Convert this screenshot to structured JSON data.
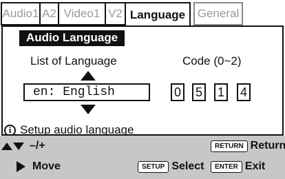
{
  "tabs": [
    {
      "label": "Audio1",
      "state": "inactive"
    },
    {
      "label": "A2",
      "state": "inactive"
    },
    {
      "label": "Video1",
      "state": "inactive"
    },
    {
      "label": "V2",
      "state": "inactive"
    },
    {
      "label": "Language",
      "state": "active"
    },
    {
      "label": "General",
      "state": "inactive"
    }
  ],
  "panel": {
    "section_title": "Audio Language",
    "list_label": "List of Language",
    "code_label": "Code (0~2)",
    "language_value": "en: English",
    "code_digits": [
      "0",
      "5",
      "1",
      "4"
    ]
  },
  "info": {
    "icon": "info-icon",
    "text": "Setup audio language"
  },
  "footer": {
    "updown_action": "–/+",
    "right_action": "Move",
    "setup_key": "SETUP",
    "setup_action": "Select",
    "return_key": "RETURN",
    "return_action": "Return",
    "enter_key": "ENTER",
    "enter_action": "Exit"
  },
  "colors": {
    "footer_bg": "#c7c7c7",
    "inactive_tab_text": "#9a9a9a",
    "section_bg": "#111111"
  }
}
